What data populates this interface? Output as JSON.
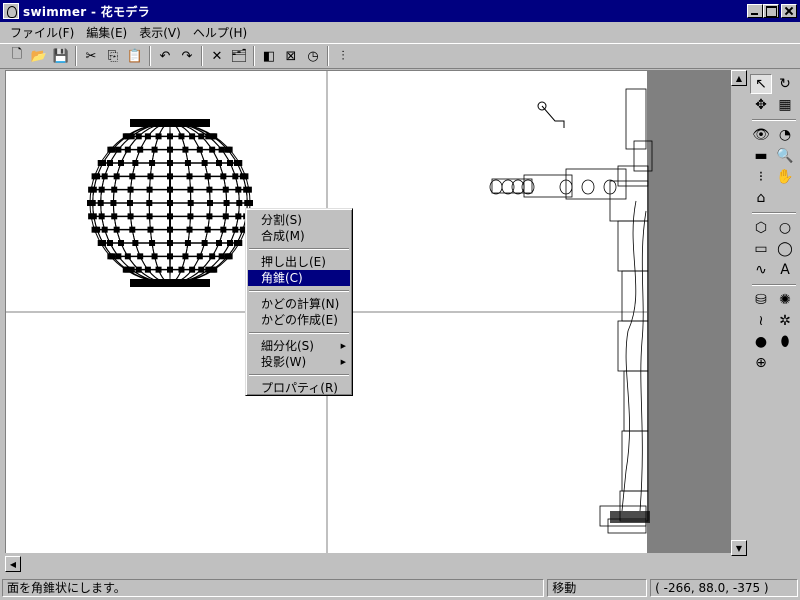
{
  "window": {
    "title": "swimmer - 花モデラ"
  },
  "menubar": [
    "ファイル(F)",
    "編集(E)",
    "表示(V)",
    "ヘルプ(H)"
  ],
  "toolbar": [
    {
      "name": "new-file",
      "glyph": "🗋"
    },
    {
      "name": "open-folder",
      "glyph": "📂"
    },
    {
      "name": "save",
      "glyph": "💾"
    },
    {
      "sep": true
    },
    {
      "name": "cut",
      "glyph": "✂"
    },
    {
      "name": "copy",
      "glyph": "⎘"
    },
    {
      "name": "paste",
      "glyph": "📋"
    },
    {
      "sep": true
    },
    {
      "name": "undo",
      "glyph": "↶"
    },
    {
      "name": "redo",
      "glyph": "↷"
    },
    {
      "sep": true
    },
    {
      "name": "delete",
      "glyph": "✕"
    },
    {
      "name": "properties",
      "glyph": "🗂"
    },
    {
      "sep": true
    },
    {
      "name": "view-mode",
      "glyph": "◧"
    },
    {
      "name": "frame",
      "glyph": "⊠"
    },
    {
      "name": "clock",
      "glyph": "◷"
    },
    {
      "sep": true
    },
    {
      "name": "color-bars",
      "glyph": "⫶"
    }
  ],
  "context_menu": {
    "groups": [
      [
        {
          "label": "分割(S)"
        },
        {
          "label": "合成(M)"
        }
      ],
      [
        {
          "label": "押し出し(E)"
        },
        {
          "label": "角錐(C)",
          "highlighted": true
        }
      ],
      [
        {
          "label": "かどの計算(N)"
        },
        {
          "label": "かどの作成(E)"
        }
      ],
      [
        {
          "label": "細分化(S)",
          "submenu": true
        },
        {
          "label": "投影(W)",
          "submenu": true
        }
      ],
      [
        {
          "label": "プロパティ(R)"
        }
      ]
    ]
  },
  "palette": [
    {
      "name": "select-arrow",
      "glyph": "↖",
      "active": true
    },
    {
      "name": "rotate",
      "glyph": "↻"
    },
    {
      "name": "move-cross",
      "glyph": "✥"
    },
    {
      "name": "grid",
      "glyph": "▦"
    },
    {
      "sep": true
    },
    {
      "name": "eye",
      "glyph": "👁"
    },
    {
      "name": "orbit",
      "glyph": "◔"
    },
    {
      "name": "plane",
      "glyph": "▬"
    },
    {
      "name": "zoom",
      "glyph": "🔍"
    },
    {
      "name": "points",
      "glyph": "⁝"
    },
    {
      "name": "hand",
      "glyph": "✋"
    },
    {
      "name": "home",
      "glyph": "⌂"
    },
    {
      "name": "blank",
      "glyph": ""
    },
    {
      "sep": true
    },
    {
      "name": "cube",
      "glyph": "⬡"
    },
    {
      "name": "circle",
      "glyph": "○"
    },
    {
      "name": "rectangle",
      "glyph": "▭"
    },
    {
      "name": "ellipse",
      "glyph": "◯"
    },
    {
      "name": "curve",
      "glyph": "∿"
    },
    {
      "name": "text",
      "glyph": "A"
    },
    {
      "sep": true
    },
    {
      "name": "cylinder",
      "glyph": "⛁"
    },
    {
      "name": "gear",
      "glyph": "✺"
    },
    {
      "name": "wave",
      "glyph": "≀"
    },
    {
      "name": "twist",
      "glyph": "✲"
    },
    {
      "name": "sphere",
      "glyph": "●"
    },
    {
      "name": "lathe",
      "glyph": "⬮"
    },
    {
      "name": "add-plus",
      "glyph": "⊕"
    }
  ],
  "statusbar": {
    "message": "面を角錐状にします。",
    "mode": "移動",
    "coords": "( -266, 88.0, -375 )"
  },
  "colors": {
    "titlebar": "#000080",
    "viewport_bg": "#ffffff",
    "viewport_gray": "#808080",
    "highlight": "#000080"
  }
}
